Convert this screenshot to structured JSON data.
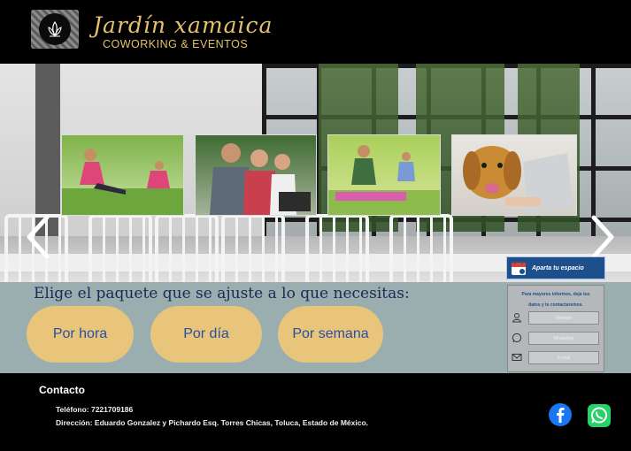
{
  "header": {
    "brand_title": "Jardín xamaica",
    "brand_subtitle": "COWORKING & EVENTOS",
    "logo_icon": "lotus-icon"
  },
  "hero": {
    "prev_arrow": "‹",
    "next_arrow": "›",
    "photos": [
      {
        "name": "yoga-stretch-photo",
        "colors": [
          "#7fb24a",
          "#c9e3a2"
        ]
      },
      {
        "name": "students-laptop-photo",
        "colors": [
          "#3f6b33",
          "#a6b39a"
        ]
      },
      {
        "name": "yoga-meditation-photo",
        "colors": [
          "#a9cf5a",
          "#d9e59a"
        ]
      },
      {
        "name": "dog-laptop-photo",
        "colors": [
          "#c98c35",
          "#e9e6e1"
        ]
      }
    ],
    "reserve_button_label": "Aparta tu espacio"
  },
  "packages": {
    "title": "Elige el paquete que se ajuste a lo que necesitas:",
    "buttons": [
      "Por hora",
      "Por día",
      "Por semana"
    ]
  },
  "contact_form": {
    "intro_line1": "Para mayores informes, deja tus",
    "intro_line2": "datos y te contactaremos.",
    "fields": [
      {
        "placeholder": "Nombre",
        "icon": "user-icon"
      },
      {
        "placeholder": "WhatsApp",
        "icon": "whatsapp-icon"
      },
      {
        "placeholder": "E-mail",
        "icon": "mail-icon"
      }
    ]
  },
  "footer": {
    "title": "Contacto",
    "phone": "Teléfono: 7221709186",
    "address": "Dirección: Eduardo Gonzalez y Pichardo Esq. Torres Chicas, Toluca, Estado de México.",
    "social": [
      "facebook-icon",
      "whatsapp-icon"
    ]
  },
  "colors": {
    "brand_gold": "#e6c36b",
    "package_bg": "#9aaeb0",
    "package_button": "#e8c57a",
    "button_text": "#2a4ea0",
    "reserve_blue": "#1d4f8c"
  }
}
